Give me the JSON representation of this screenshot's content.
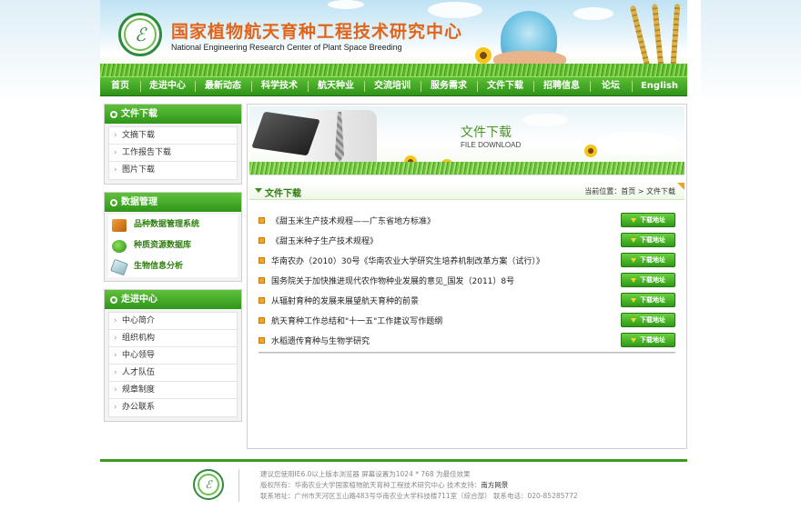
{
  "header": {
    "title_cn": "国家植物航天育种工程技术研究中心",
    "title_en": "National Engineering Research Center of Plant Space Breeding"
  },
  "nav": {
    "items": [
      "首页",
      "走进中心",
      "最新动态",
      "科学技术",
      "航天种业",
      "交流培训",
      "服务需求",
      "文件下载",
      "招聘信息",
      "论坛",
      "English"
    ]
  },
  "sidebar": {
    "downloads": {
      "title": "文件下载",
      "items": [
        "文摘下载",
        "工作报告下载",
        "图片下载"
      ]
    },
    "data": {
      "title": "数据管理",
      "items": [
        {
          "label": "品种数据管理系统",
          "icon": "database-icon"
        },
        {
          "label": "种质资源数据库",
          "icon": "plant-icon"
        },
        {
          "label": "生物信息分析",
          "icon": "analysis-icon"
        }
      ]
    },
    "about": {
      "title": "走进中心",
      "items": [
        "中心简介",
        "组织机构",
        "中心领导",
        "人才队伍",
        "规章制度",
        "办公联系"
      ]
    }
  },
  "banner": {
    "title": "文件下载",
    "subtitle": "FILE DOWNLOAD"
  },
  "section": {
    "title": "文件下载",
    "breadcrumb": "当前位置：首页 > 文件下载"
  },
  "files": {
    "button_label": "下载地址",
    "items": [
      "《甜玉米生产技术规程——广东省地方标准》",
      "《甜玉米种子生产技术规程》",
      "华南农办（2010）30号《华南农业大学研究生培养机制改革方案（试行）》",
      "国务院关于加快推进现代农作物种业发展的意见_国发（2011）8号",
      "从辐射育种的发展来展望航天育种的前景",
      "航天育种工作总结和\"十一五\"工作建议写作题纲",
      "水稻遗传育种与生物学研究"
    ]
  },
  "footer": {
    "line1": "建议您使用IE6.0以上版本浏览器 屏幕设置为1024 * 768 为最佳效果",
    "line2_prefix": "版权所有：华南农业大学国家植物航天育种工程技术研究中心   技术支持：",
    "line2_support": "南方网景",
    "line3": "联系地址：广州市天河区五山路483号华南农业大学科技楼711室（综合部）  联系电话：020-85285772"
  },
  "colors": {
    "brand_green": "#2f9619",
    "title_orange": "#e0651b",
    "accent_green_text": "#2f7d10"
  }
}
